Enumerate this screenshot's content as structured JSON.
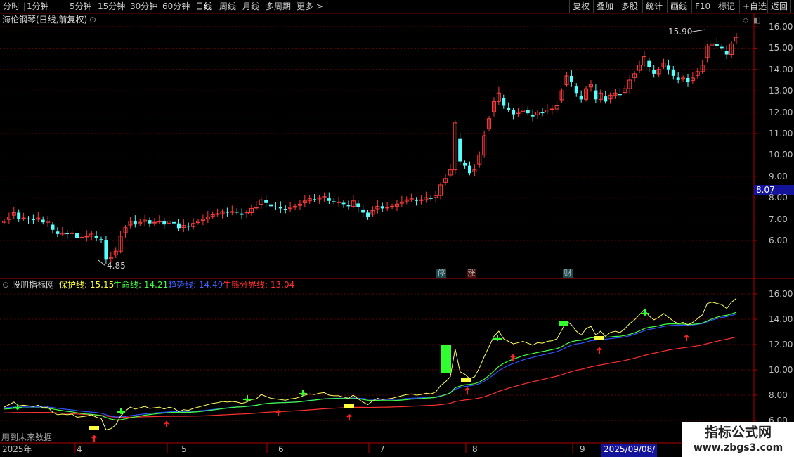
{
  "toolbar": {
    "periods": [
      "分时",
      "1分钟",
      "5分钟",
      "15分钟",
      "30分钟",
      "60分钟",
      "日线",
      "周线",
      "月线",
      "多周期",
      "更多 >"
    ],
    "active_period": "日线",
    "right_buttons": [
      "复权",
      "叠加",
      "多股",
      "统计",
      "画线",
      "F10",
      "标记",
      "+自选",
      "返回"
    ]
  },
  "upper": {
    "title": "海伦钢琴(日线,前复权)",
    "high_label": "15.90",
    "low_label": "4.85",
    "price_badge": "8.07",
    "y_ticks": [
      "16.00",
      "15.00",
      "14.00",
      "13.00",
      "12.00",
      "11.00",
      "10.00",
      "9.00",
      "8.00",
      "7.00",
      "6.00"
    ],
    "events": [
      {
        "label": "停",
        "color": "#4fd6e0"
      },
      {
        "label": "涨",
        "color": "#ff4040"
      },
      {
        "label": "财",
        "color": "#4fd6e0"
      }
    ]
  },
  "lower": {
    "title": "股朋指标网",
    "legend": [
      {
        "label": "保护线:",
        "value": "15.15",
        "color": "#ffff40"
      },
      {
        "label": "生命线:",
        "value": "14.21",
        "color": "#40ff40"
      },
      {
        "label": "趋势线:",
        "value": "14.49",
        "color": "#4040ff"
      },
      {
        "label": "牛熊分界线:",
        "value": "13.04",
        "color": "#ff3030"
      }
    ],
    "y_ticks": [
      "16.00",
      "14.00",
      "12.00",
      "10.00",
      "8.00",
      "6.00"
    ],
    "note": "用到未来数据"
  },
  "x_axis": {
    "labels": [
      "2025年",
      "4",
      "5",
      "6",
      "7",
      "8",
      "9"
    ],
    "cursor_date": "2025/09/08/—"
  },
  "watermark": {
    "line1": "指标公式网",
    "line2": "www.zbgs3.com"
  },
  "chart_data": {
    "type": "candlestick",
    "title": "海伦钢琴(日线,前复权)",
    "y_range": [
      5.0,
      16.3
    ],
    "annotations": {
      "high": 15.9,
      "low": 4.85,
      "last": 8.07
    },
    "closes": [
      6.9,
      7.1,
      7.3,
      7.0,
      7.05,
      7.0,
      6.95,
      7.05,
      6.85,
      6.9,
      6.5,
      6.3,
      6.35,
      6.3,
      6.35,
      6.1,
      6.15,
      6.2,
      6.3,
      6.1,
      6.0,
      5.1,
      5.2,
      5.5,
      6.2,
      6.6,
      6.9,
      6.75,
      6.85,
      6.95,
      6.8,
      6.85,
      6.9,
      6.75,
      6.9,
      6.8,
      6.55,
      6.7,
      6.65,
      6.8,
      6.9,
      7.0,
      7.1,
      7.2,
      7.25,
      7.35,
      7.3,
      7.35,
      7.3,
      7.2,
      7.3,
      7.5,
      7.55,
      7.9,
      7.75,
      7.6,
      7.55,
      7.5,
      7.45,
      7.55,
      7.6,
      7.7,
      7.85,
      7.95,
      7.9,
      8.0,
      8.05,
      7.85,
      7.8,
      7.8,
      7.7,
      7.6,
      7.85,
      7.55,
      7.3,
      7.1,
      7.4,
      7.6,
      7.5,
      7.55,
      7.6,
      7.7,
      7.8,
      7.9,
      7.95,
      7.85,
      7.9,
      8.0,
      7.95,
      8.1,
      8.6,
      8.9,
      9.3,
      11.5,
      9.7,
      9.5,
      9.15,
      9.3,
      10.0,
      10.9,
      11.7,
      12.5,
      12.9,
      12.3,
      12.1,
      11.9,
      12.0,
      12.1,
      11.95,
      11.8,
      12.0,
      11.95,
      12.1,
      12.15,
      12.3,
      13.0,
      13.7,
      13.4,
      12.9,
      12.6,
      13.1,
      13.3,
      12.6,
      12.9,
      12.5,
      12.8,
      12.9,
      12.8,
      13.1,
      13.5,
      13.8,
      14.2,
      14.6,
      14.1,
      13.8,
      14.0,
      14.3,
      14.0,
      13.7,
      13.5,
      13.6,
      13.4,
      13.6,
      13.9,
      14.2,
      15.1,
      15.2,
      15.1,
      15.0,
      14.7,
      15.2,
      15.5
    ],
    "lines": {
      "保护线": {
        "color": "#ffff40",
        "last": 15.15
      },
      "生命线": {
        "color": "#40ff40",
        "last": 14.21
      },
      "趋势线": {
        "color": "#4040ff",
        "last": 14.49
      },
      "牛熊分界线": {
        "color": "#ff3030",
        "last": 13.04
      }
    }
  }
}
